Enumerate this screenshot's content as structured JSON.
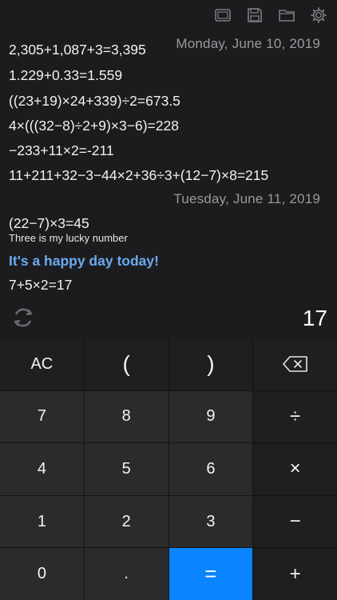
{
  "toolbar": {
    "icons": [
      "screen-icon",
      "save-icon",
      "folder-icon",
      "gear-icon"
    ]
  },
  "history": {
    "date1": "Monday, June 10, 2019",
    "entries1": [
      "2,305+1,087+3=3,395",
      "1.229+0.33=1.559",
      "((23+19)×24+339)÷2=673.5",
      "4×(((32−8)÷2+9)×3−6)=228",
      "−233+11×2=-211",
      "11+211+32−3−44×2+36÷3+(12−7)×8=215"
    ],
    "date2": "Tuesday, June 11, 2019",
    "entry_with_note": "(22−7)×3=45",
    "note": "Three is my lucky number",
    "highlight": "It's a happy day today!",
    "last_entry": "7+5×2=17"
  },
  "result": {
    "value": "17"
  },
  "keypad": {
    "ac": "AC",
    "lparen": "(",
    "rparen": ")",
    "k7": "7",
    "k8": "8",
    "k9": "9",
    "div": "÷",
    "k4": "4",
    "k5": "5",
    "k6": "6",
    "mul": "×",
    "k1": "1",
    "k2": "2",
    "k3": "3",
    "sub": "−",
    "k0": "0",
    "dot": ".",
    "eq": "=",
    "add": "+"
  },
  "colors": {
    "background": "#1c1c1e",
    "key": "#2b2b2d",
    "key_dark": "#1f1f21",
    "accent": "#0a84ff",
    "highlight_text": "#6aaaf0",
    "date_text": "#9a9a9e"
  }
}
